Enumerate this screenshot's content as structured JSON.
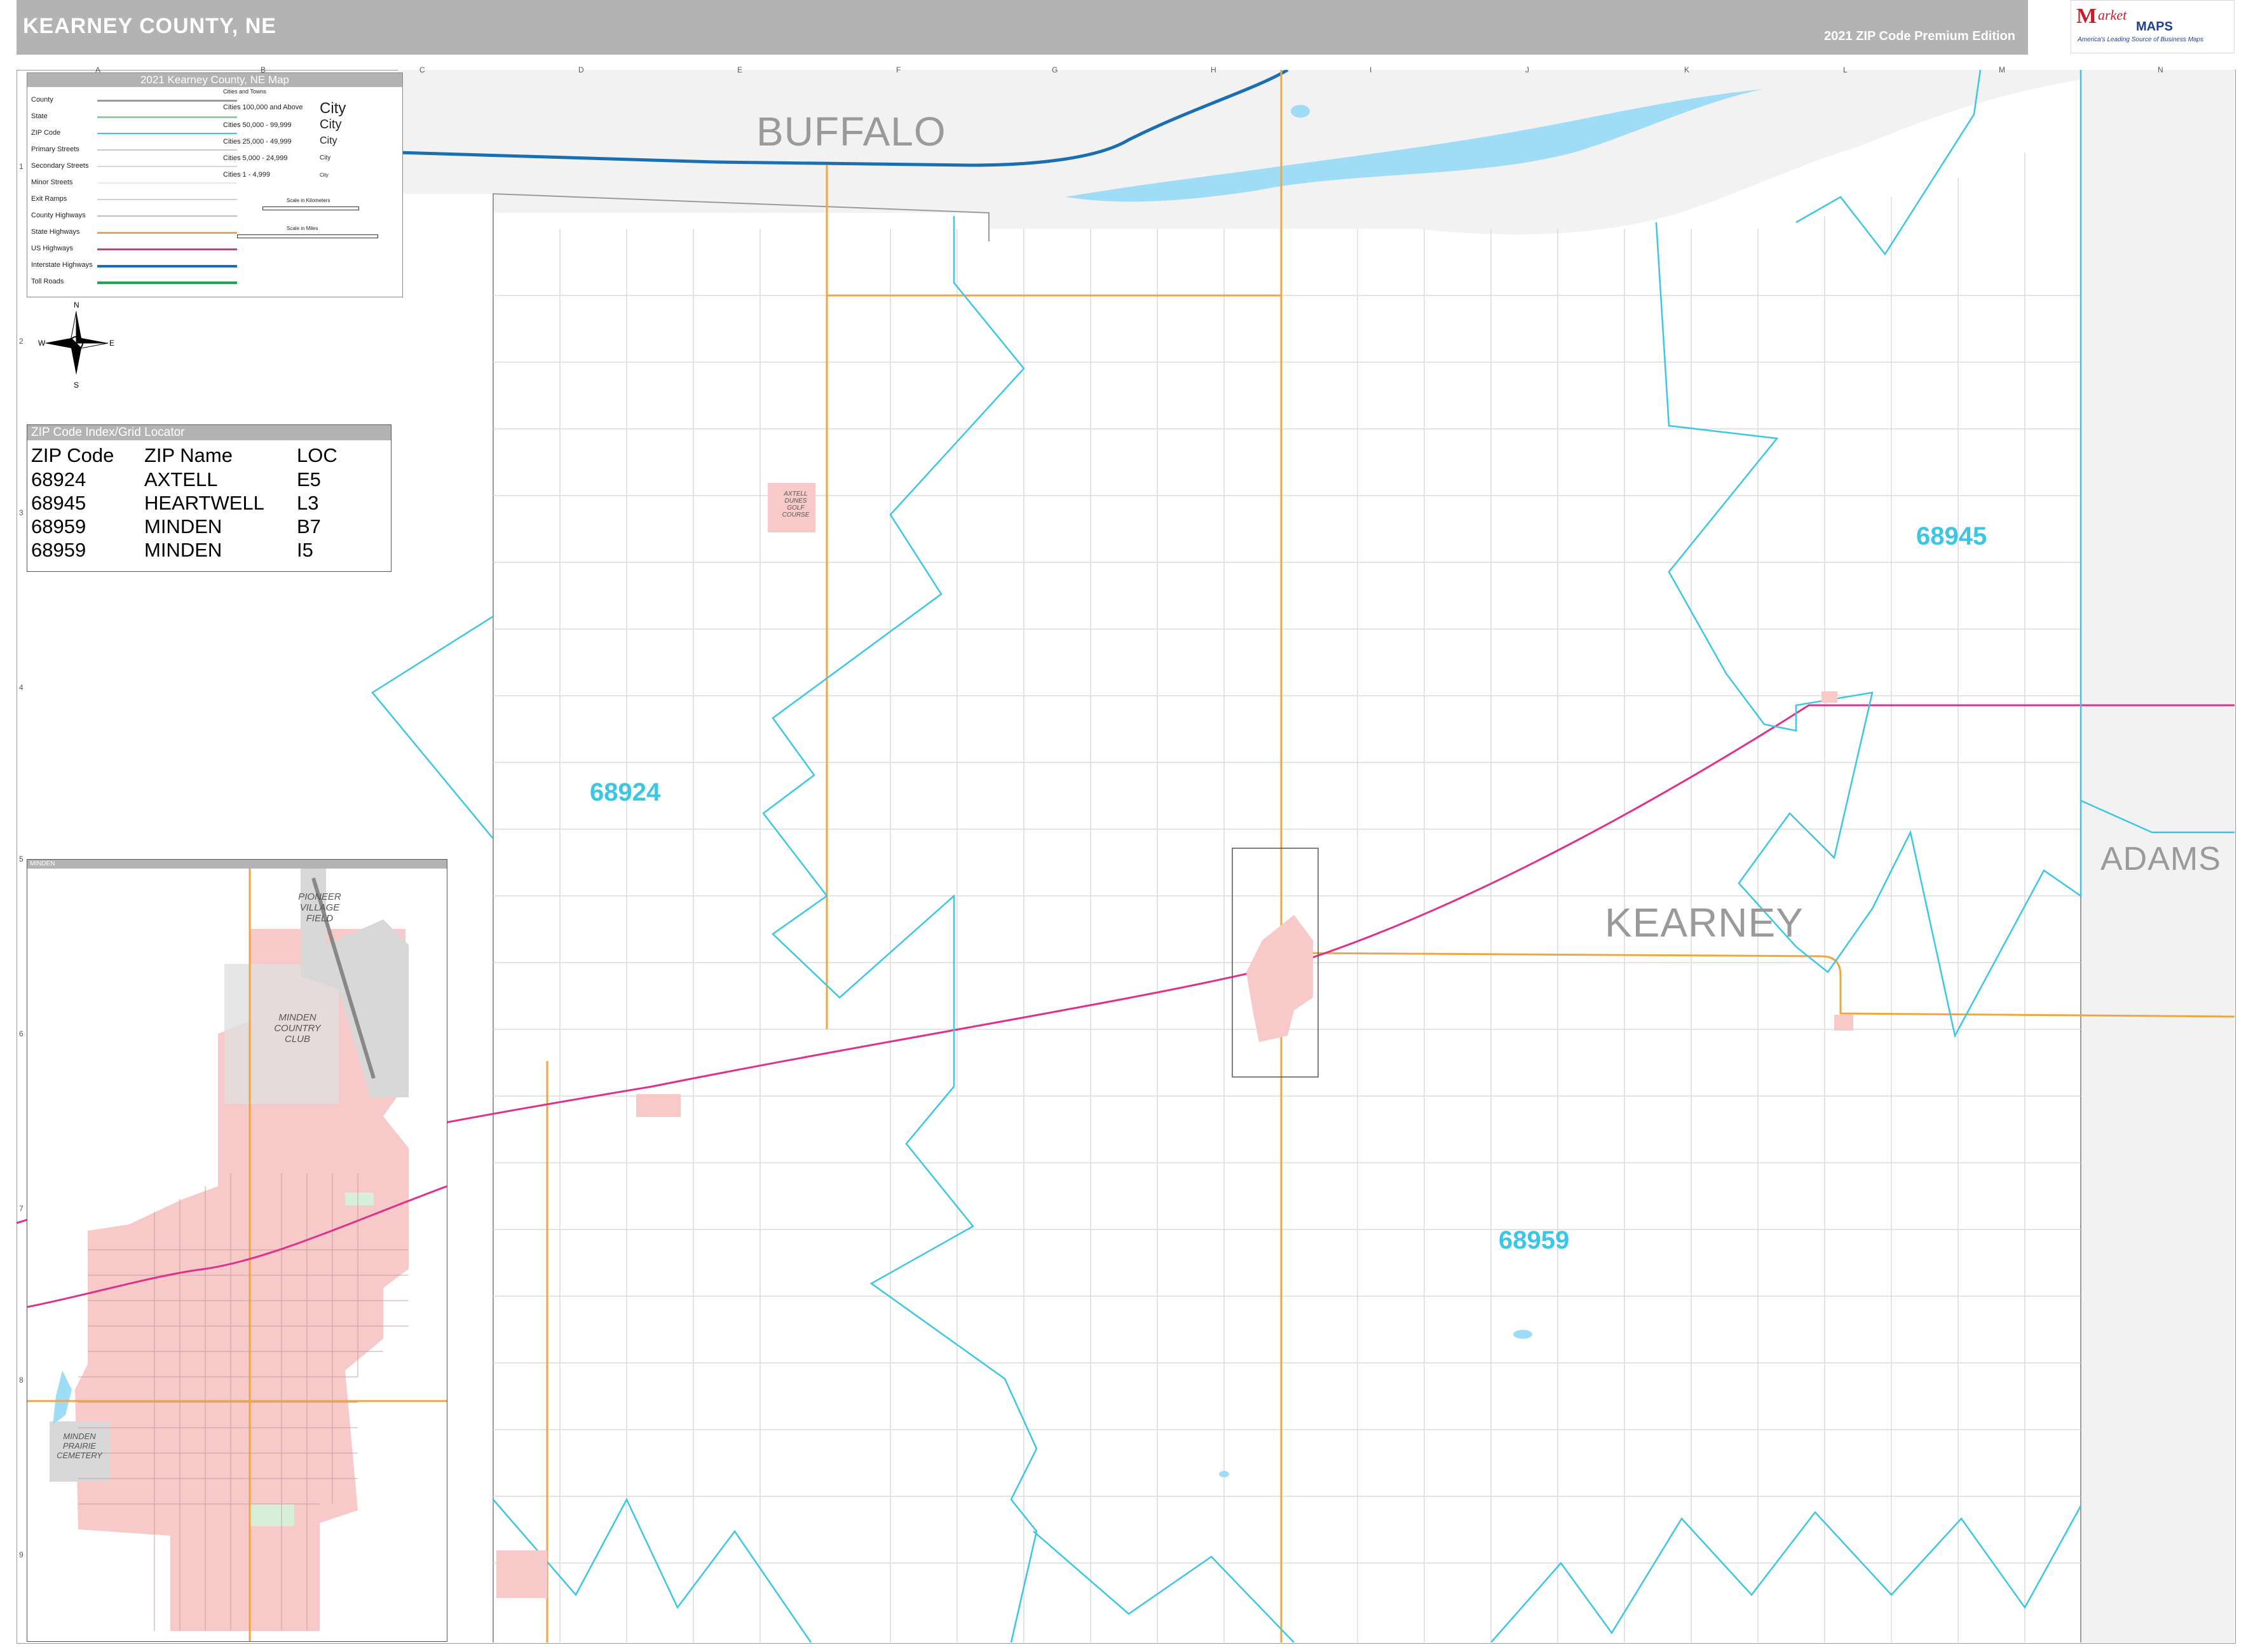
{
  "header": {
    "title": "KEARNEY COUNTY, NE",
    "edition": "2021 ZIP Code Premium Edition"
  },
  "logo": {
    "m": "M",
    "arket": "arket",
    "maps": "MAPS",
    "tagline": "America's Leading Source of Business Maps"
  },
  "grid": {
    "columns": [
      "A",
      "B",
      "C",
      "D",
      "E",
      "F",
      "G",
      "H",
      "I",
      "J",
      "K",
      "L",
      "M",
      "N"
    ],
    "rows": [
      "1",
      "2",
      "3",
      "4",
      "5",
      "6",
      "7",
      "8",
      "9"
    ]
  },
  "legend": {
    "title": "2021 Kearney County, NE Map",
    "items": [
      {
        "label": "County",
        "color": "#9a9a9a"
      },
      {
        "label": "State",
        "color": "#7dd99a"
      },
      {
        "label": "ZIP Code",
        "color": "#3cc6e6"
      },
      {
        "label": "Primary Streets",
        "color": "#c8c8c8"
      },
      {
        "label": "Secondary Streets",
        "color": "#d8d8d8"
      },
      {
        "label": "Minor Streets",
        "color": "#e8e8e8"
      },
      {
        "label": "Exit Ramps",
        "color": "#d0d0d0"
      },
      {
        "label": "County Highways",
        "color": "#bdbdbd"
      },
      {
        "label": "State Highways",
        "color": "#f0a640"
      },
      {
        "label": "US Highways",
        "color": "#e0308a"
      },
      {
        "label": "Interstate Highways",
        "color": "#1a6fb3"
      },
      {
        "label": "Toll Roads",
        "color": "#1aa84a"
      }
    ],
    "cities_heading": "Cities and Towns",
    "cities": [
      {
        "label": "Cities 100,000 and Above",
        "sample": "City"
      },
      {
        "label": "Cities 50,000 - 99,999",
        "sample": "City"
      },
      {
        "label": "Cities 25,000 - 49,999",
        "sample": "City"
      },
      {
        "label": "Cities 5,000 - 24,999",
        "sample": "City"
      },
      {
        "label": "Cities 1 - 4,999",
        "sample": "City"
      }
    ],
    "scale_km": "Scale in Kilometers",
    "scale_mi": "Scale in Miles"
  },
  "compass": {
    "n": "N",
    "s": "S",
    "e": "E",
    "w": "W"
  },
  "zip_index": {
    "title": "ZIP Code Index/Grid Locator",
    "headers": [
      "ZIP Code",
      "ZIP Name",
      "LOC"
    ],
    "rows": [
      [
        "68924",
        "AXTELL",
        "E5"
      ],
      [
        "68945",
        "HEARTWELL",
        "L3"
      ],
      [
        "68959",
        "MINDEN",
        "B7"
      ],
      [
        "68959",
        "MINDEN",
        "I5"
      ]
    ]
  },
  "map": {
    "counties": [
      "BUFFALO",
      "KEARNEY",
      "ADAMS"
    ],
    "zip_labels": [
      "68924",
      "68945",
      "68959"
    ],
    "places": [
      "AXTELL DUNES GOLF COURSE"
    ]
  },
  "inset": {
    "title": "MINDEN",
    "labels": [
      "PIONEER VILLAGE FIELD",
      "MINDEN COUNTRY CLUB",
      "MINDEN PRAIRIE CEMETERY"
    ]
  },
  "colors": {
    "zip_boundary": "#3cc6e6",
    "us_highway": "#e0308a",
    "state_highway": "#f0a640",
    "interstate": "#1a6fb3",
    "water": "#9fdcf5",
    "city_fill": "#f7c9c9",
    "header_gray": "#b3b3b3"
  }
}
